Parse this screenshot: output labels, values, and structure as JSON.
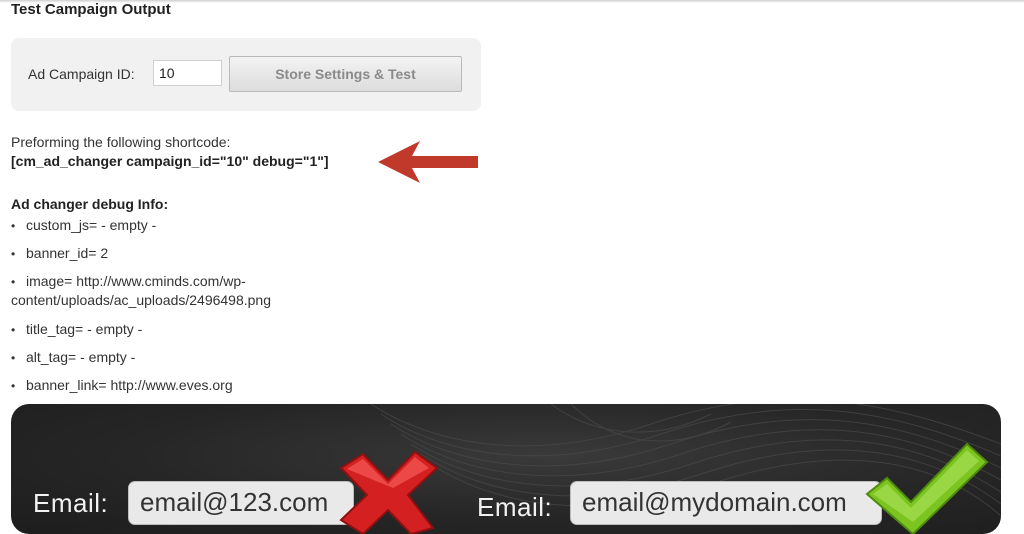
{
  "header": {
    "title": "Test Campaign Output"
  },
  "settings": {
    "campaign_label": "Ad Campaign ID:",
    "campaign_value": "10",
    "store_button_label": "Store Settings & Test"
  },
  "shortcode": {
    "intro": "Preforming the following shortcode:",
    "code": "[cm_ad_changer campaign_id=\"10\" debug=\"1\"]",
    "arrow_icon": "left-arrow-icon",
    "arrow_color": "#c0392b"
  },
  "debug": {
    "title": "Ad changer debug Info:",
    "items": [
      "custom_js= - empty -",
      "banner_id= 2",
      "image= http://www.cminds.com/wp-",
      "content/uploads/ac_uploads/2496498.png",
      "title_tag= - empty -",
      "alt_tag= - empty -",
      "banner_link= http://www.eves.org"
    ]
  },
  "banner": {
    "left_label": "Email:",
    "left_value": "email@123.com",
    "left_icon": "red-x-icon",
    "right_label": "Email:",
    "right_value": "email@mydomain.com",
    "right_icon": "green-check-icon",
    "colors": {
      "background": "#262626",
      "cross": "#d42020",
      "check": "#7cc41f"
    }
  }
}
